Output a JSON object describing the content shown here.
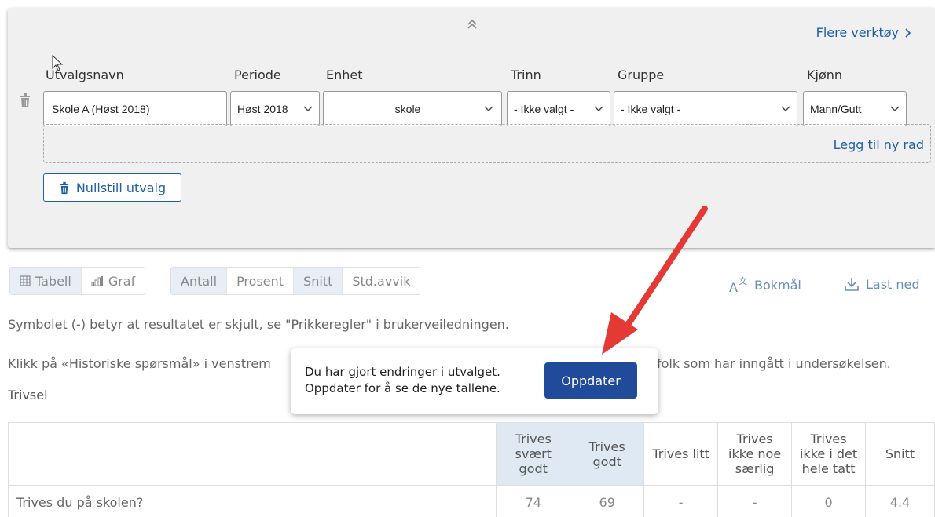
{
  "panel": {
    "more_tools": "Flere verktøy",
    "columns": {
      "name": "Utvalgsnavn",
      "period": "Periode",
      "unit": "Enhet",
      "grade": "Trinn",
      "group": "Gruppe",
      "gender": "Kjønn"
    },
    "row": {
      "name_value": "Skole A (Høst 2018)",
      "period_value": "Høst 2018",
      "unit_value": "skole",
      "grade_value": "- Ikke valgt -",
      "group_value": "- Ikke valgt -",
      "gender_value": "Mann/Gutt"
    },
    "add_row": "Legg til ny rad",
    "reset": "Nullstill utvalg"
  },
  "view_toggle": {
    "table": "Tabell",
    "graph": "Graf"
  },
  "measure_toggle": [
    "Antall",
    "Prosent",
    "Snitt",
    "Std.avvik"
  ],
  "language": "Bokmål",
  "download": "Last ned",
  "info_lines": [
    "Symbolet (-) betyr at resultatet er skjult, se \"Prikkeregler\" i brukerveiledningen.",
    "Klikk på «Historiske spørsmål» i venstrem",
    "folk som har inngått i undersøkelsen."
  ],
  "section_title": "Trivsel",
  "popup": {
    "line1": "Du har gjort endringer i utvalget.",
    "line2": "Oppdater for å se de nye tallene.",
    "button": "Oppdater"
  },
  "table": {
    "headers": [
      "",
      "Trives svært godt",
      "Trives godt",
      "Trives litt",
      "Trives ikke noe særlig",
      "Trives ikke i det hele tatt",
      "Snitt"
    ],
    "rows": [
      [
        "Trives du på skolen?",
        "74",
        "69",
        "-",
        "-",
        "0",
        "4.4"
      ]
    ]
  },
  "colors": {
    "accent": "#1f5fa8",
    "button": "#1f4b9a",
    "arrow": "#e53935"
  }
}
